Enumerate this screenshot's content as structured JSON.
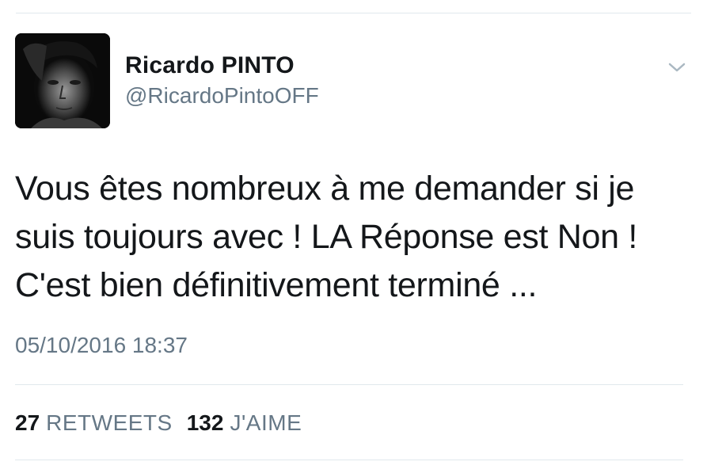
{
  "tweet": {
    "display_name": "Ricardo PINTO",
    "handle": "@RicardoPintoOFF",
    "text": "Vous êtes nombreux à me demander si je\nsuis toujours avec ! LA Réponse est Non !\nC'est bien définitivement terminé ...",
    "timestamp": "05/10/2016 18:37",
    "retweets_count": "27",
    "retweets_label": "RETWEETS",
    "likes_count": "132",
    "likes_label": "J'AIME",
    "chevron_icon": "chevron-down-icon"
  },
  "colors": {
    "text_primary": "#14171a",
    "text_secondary": "#657786",
    "divider": "#e1e8ed"
  }
}
